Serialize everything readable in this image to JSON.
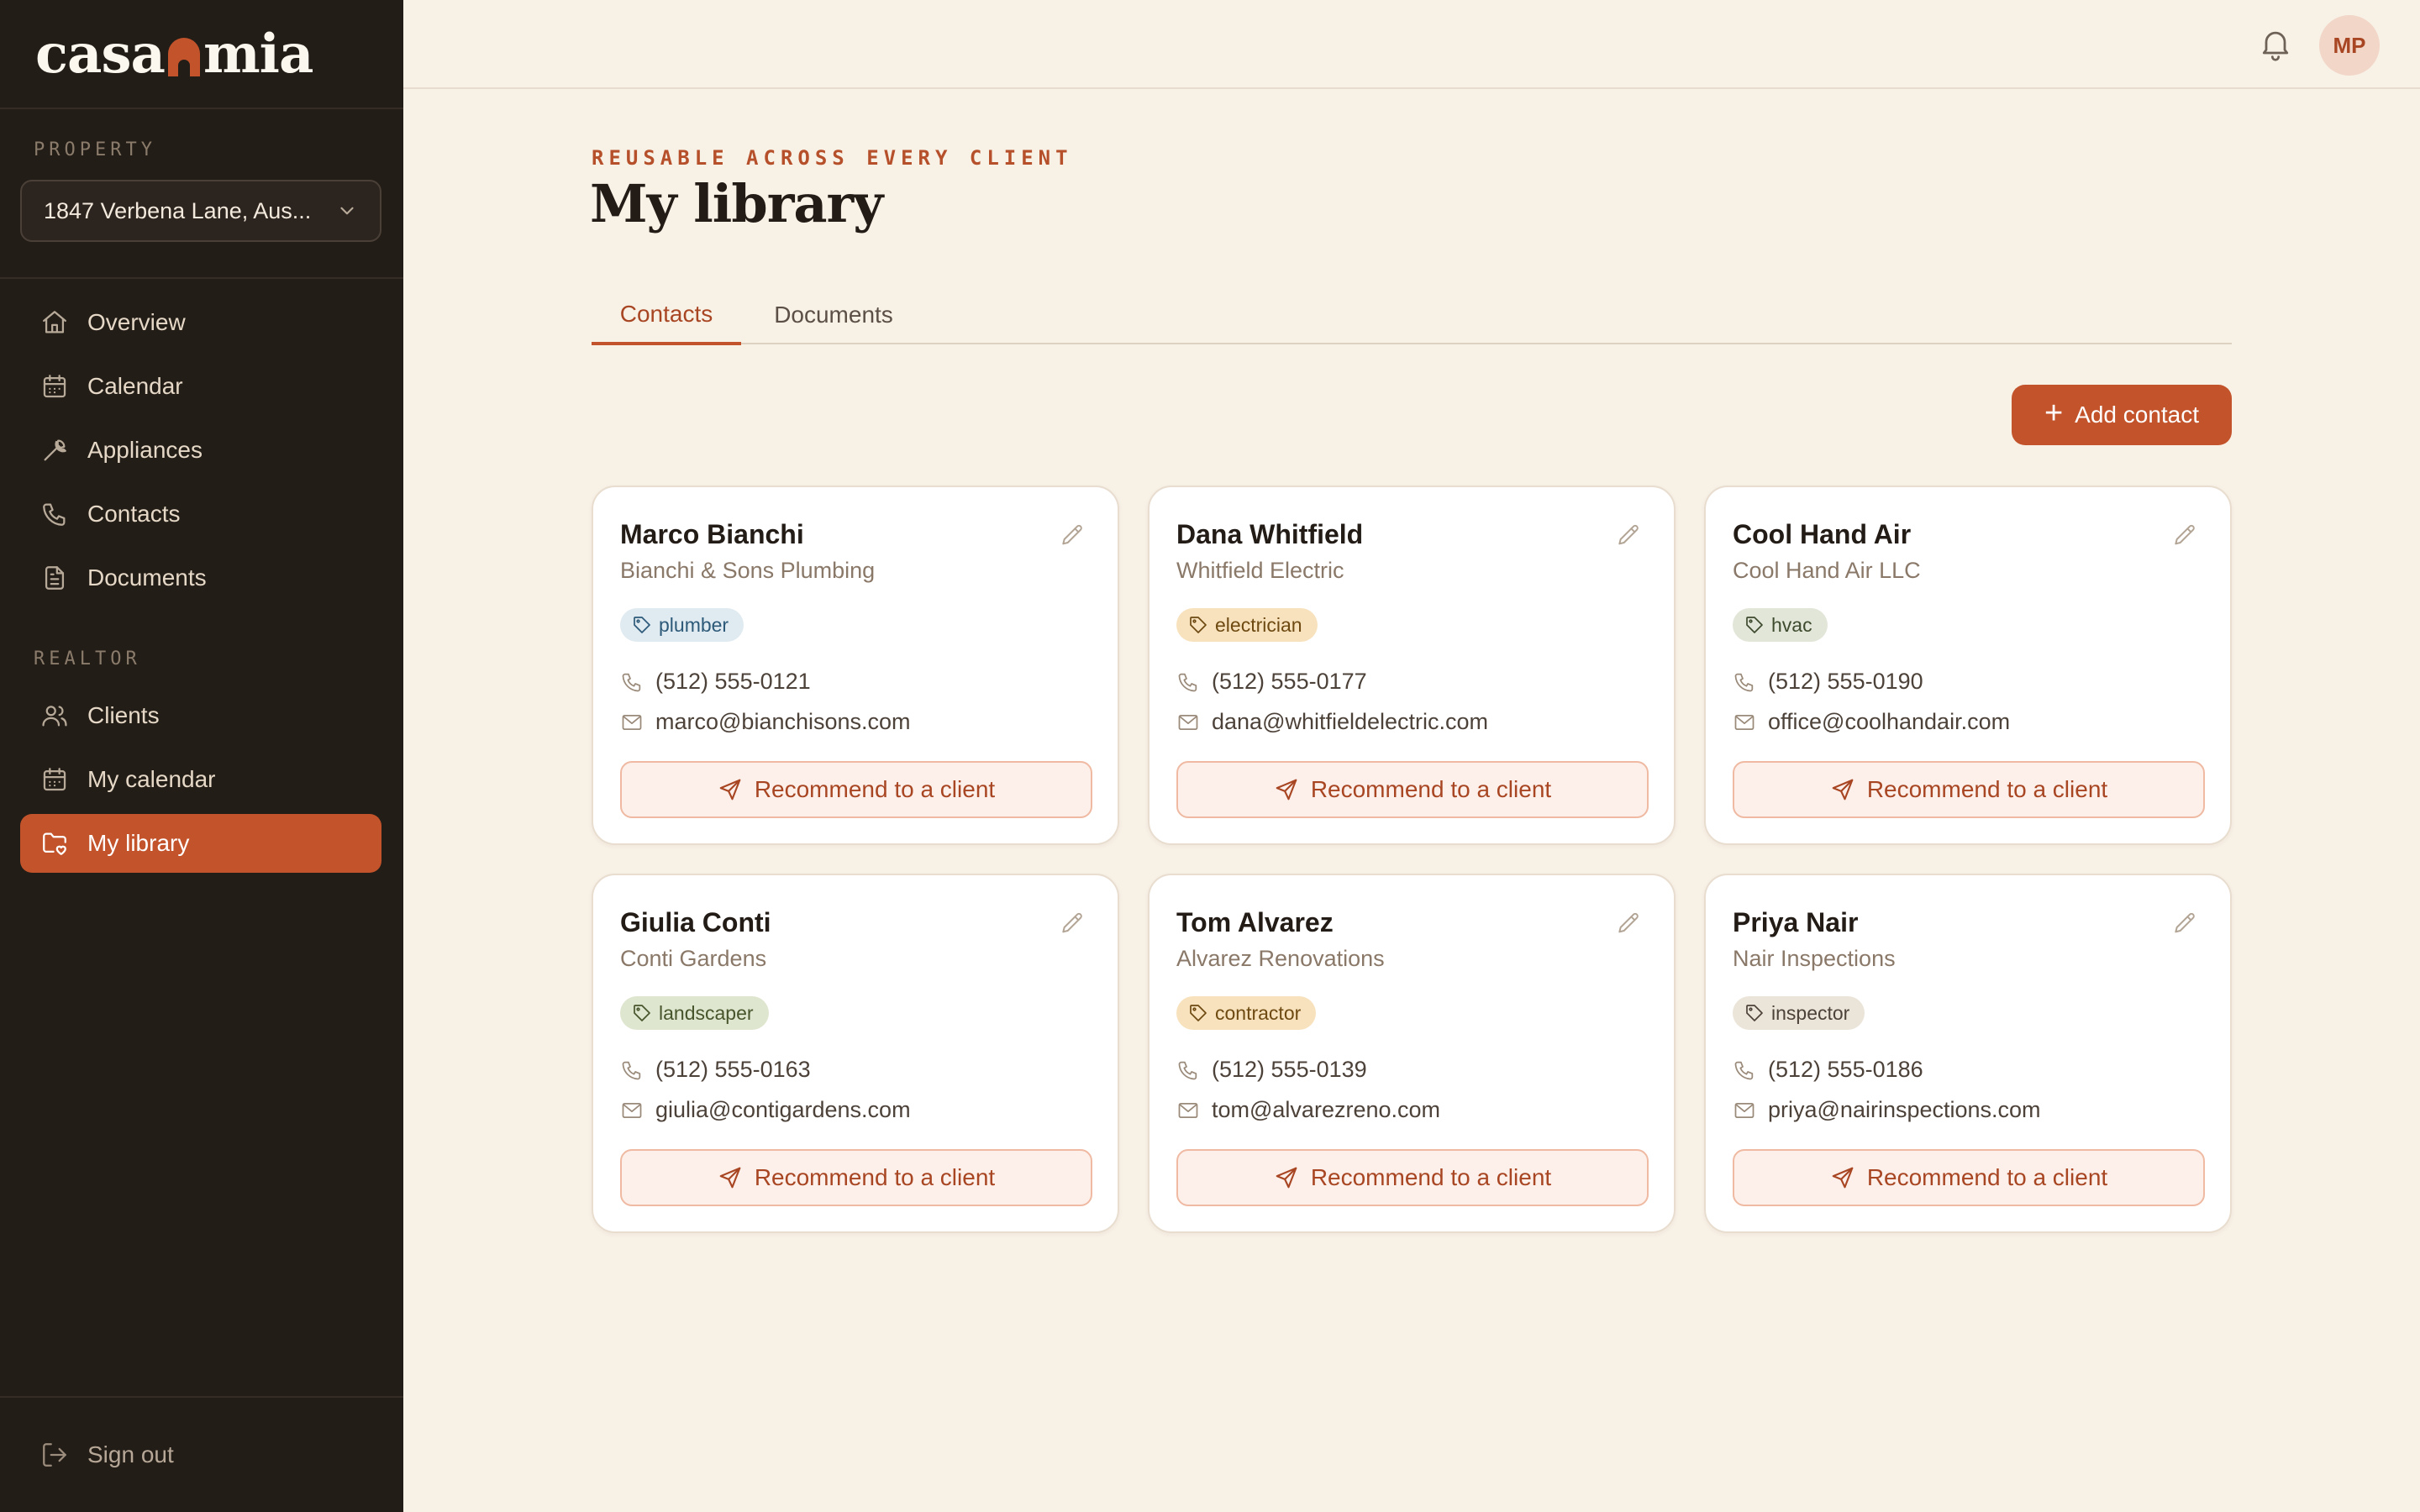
{
  "brand": {
    "name_left": "casa",
    "name_right": "mia",
    "logo_icon": "arch-icon",
    "accent_color": "#c2532b"
  },
  "sidebar": {
    "property_label": "PROPERTY",
    "property_value": "1847 Verbena Lane, Aus...",
    "nav": [
      {
        "label": "Overview",
        "icon": "home-icon"
      },
      {
        "label": "Calendar",
        "icon": "calendar-icon"
      },
      {
        "label": "Appliances",
        "icon": "wrench-icon"
      },
      {
        "label": "Contacts",
        "icon": "phone-icon"
      },
      {
        "label": "Documents",
        "icon": "document-icon"
      }
    ],
    "realtor_label": "REALTOR",
    "realtor_nav": [
      {
        "label": "Clients",
        "icon": "users-icon"
      },
      {
        "label": "My calendar",
        "icon": "calendar-icon"
      },
      {
        "label": "My library",
        "icon": "folder-heart-icon",
        "active": true
      }
    ],
    "signout_label": "Sign out"
  },
  "topbar": {
    "avatar_initials": "MP",
    "bell_icon": "bell-icon"
  },
  "main": {
    "eyebrow": "REUSABLE ACROSS EVERY CLIENT",
    "title": "My library",
    "tabs": [
      {
        "label": "Contacts",
        "active": true
      },
      {
        "label": "Documents",
        "active": false
      }
    ],
    "add_button_label": "Add contact",
    "recommend_label": "Recommend to a client",
    "contacts": [
      {
        "name": "Marco Bianchi",
        "company": "Bianchi & Sons Plumbing",
        "tag": "plumber",
        "tag_bg": "#dfeaf1",
        "tag_fg": "#2d5a78",
        "phone": "(512) 555-0121",
        "email": "marco@bianchisons.com"
      },
      {
        "name": "Dana Whitfield",
        "company": "Whitfield Electric",
        "tag": "electrician",
        "tag_bg": "#f7e2bd",
        "tag_fg": "#6e4a12",
        "phone": "(512) 555-0177",
        "email": "dana@whitfieldelectric.com"
      },
      {
        "name": "Cool Hand Air",
        "company": "Cool Hand Air LLC",
        "tag": "hvac",
        "tag_bg": "#e2e6d8",
        "tag_fg": "#3e4a2e",
        "phone": "(512) 555-0190",
        "email": "office@coolhandair.com"
      },
      {
        "name": "Giulia Conti",
        "company": "Conti Gardens",
        "tag": "landscaper",
        "tag_bg": "#dfe6cf",
        "tag_fg": "#47552c",
        "phone": "(512) 555-0163",
        "email": "giulia@contigardens.com"
      },
      {
        "name": "Tom Alvarez",
        "company": "Alvarez Renovations",
        "tag": "contractor",
        "tag_bg": "#f7e2bd",
        "tag_fg": "#6e4a12",
        "phone": "(512) 555-0139",
        "email": "tom@alvarezreno.com"
      },
      {
        "name": "Priya Nair",
        "company": "Nair Inspections",
        "tag": "inspector",
        "tag_bg": "#ebe4d9",
        "tag_fg": "#4d4239",
        "phone": "(512) 555-0186",
        "email": "priya@nairinspections.com"
      }
    ]
  }
}
